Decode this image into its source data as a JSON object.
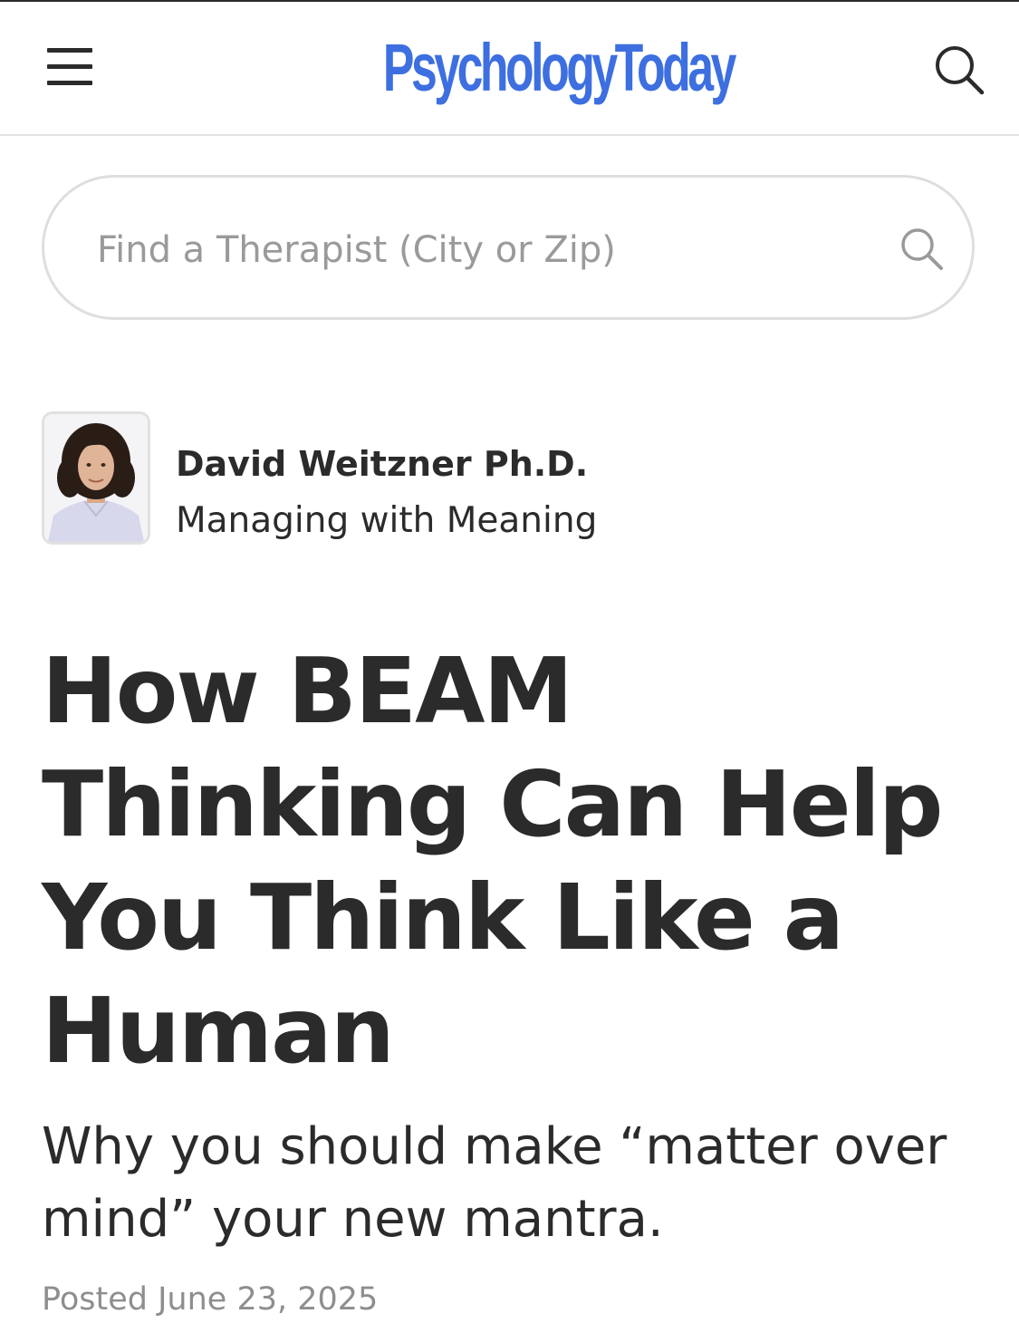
{
  "header": {
    "logo_text": "PsychologyToday",
    "logo_color": "#3d6fe0",
    "menu_icon": "hamburger-menu-icon",
    "search_icon": "search-icon"
  },
  "therapist_search": {
    "placeholder": "Find a Therapist (City or Zip)",
    "value": "",
    "icon": "search-icon"
  },
  "author": {
    "photo": "author-avatar",
    "name": "David Weitzner Ph.D.",
    "blog": "Managing with Meaning"
  },
  "article": {
    "title": "How BEAM Thinking Can Help You Think Like a Human",
    "subtitle": "Why you should make “matter over mind” your new mantra.",
    "posted": "Posted June 23, 2025"
  },
  "colors": {
    "text": "#2b2b2b",
    "muted_text": "#8e8e8e",
    "placeholder": "#9a9a9a",
    "border": "#dedede"
  }
}
